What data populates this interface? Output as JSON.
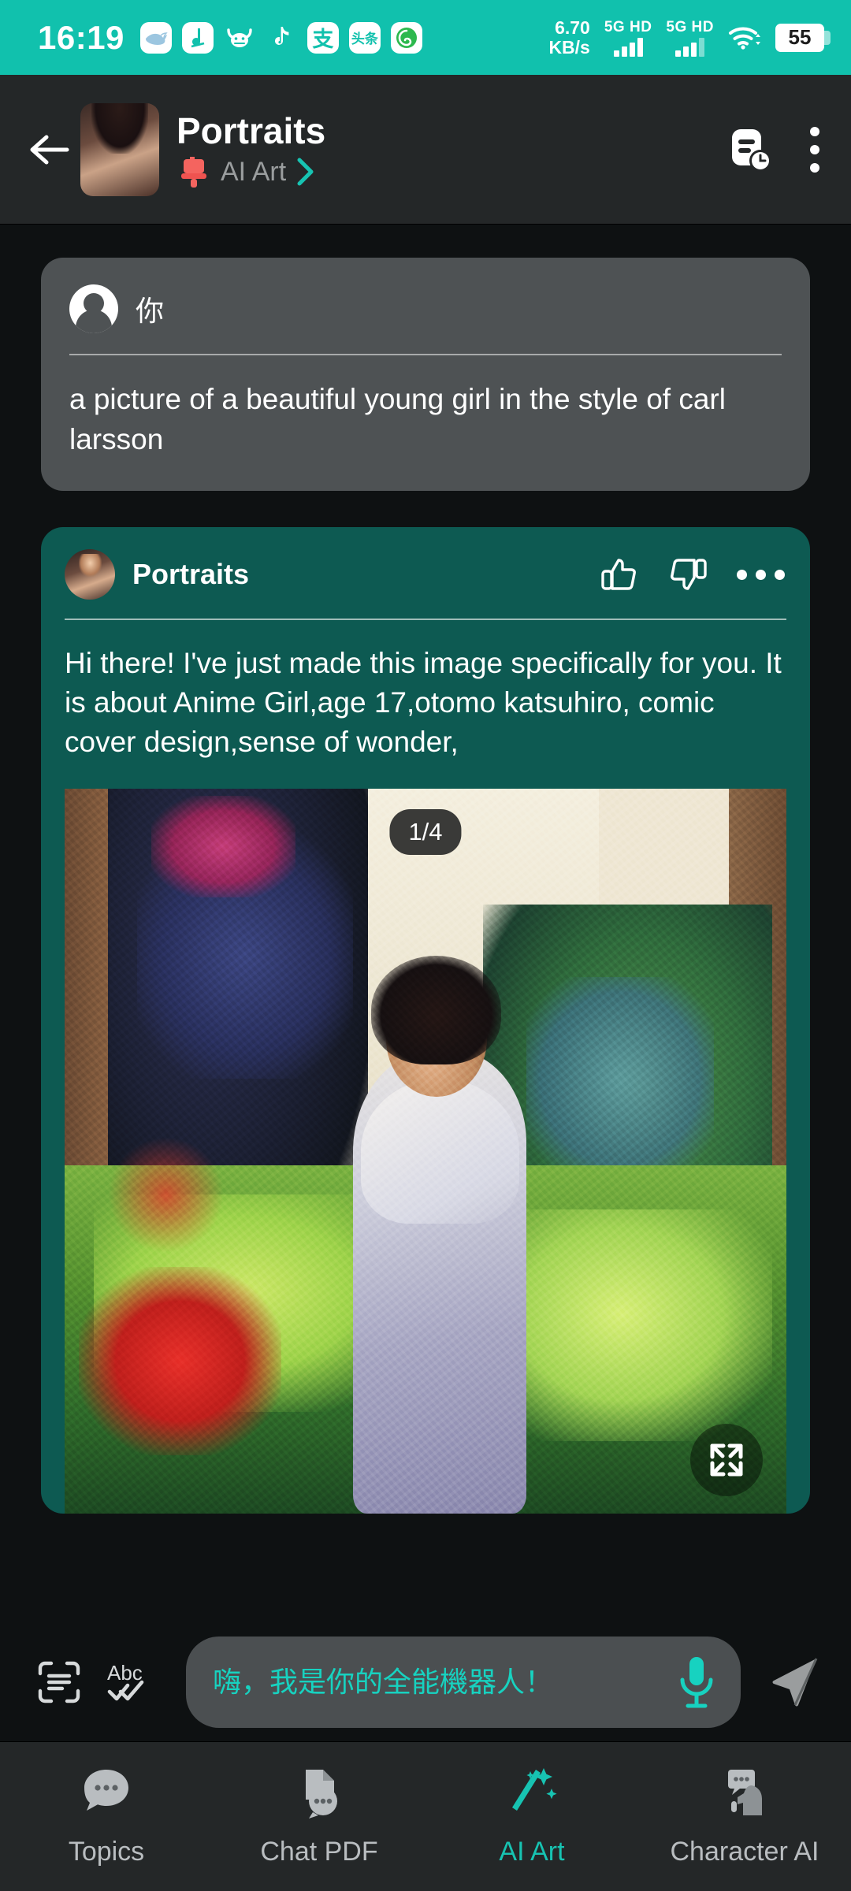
{
  "status_bar": {
    "time": "16:19",
    "app_icons": [
      "whale-icon",
      "j-note-icon",
      "ox-face-icon",
      "tiktok-icon",
      "alipay-icon",
      "toutiao-icon",
      "spiral-icon"
    ],
    "alipay_glyph": "支",
    "toutiao_glyph": "头条",
    "j_glyph": "J",
    "network_speed_value": "6.70",
    "network_speed_unit": "KB/s",
    "sim1_label": "5G HD",
    "sim2_label": "5G HD",
    "wifi_icon": "wifi-icon",
    "battery_percent": "55",
    "bg_color": "#11c1ad"
  },
  "header": {
    "back_icon": "back-arrow-icon",
    "avatar": "portraits-avatar",
    "title": "Portraits",
    "category_icon": "paintbrush-icon",
    "category_label": "AI Art",
    "chevron_icon": "chevron-right-icon",
    "history_icon": "history-document-icon",
    "overflow_icon": "more-vertical-icon",
    "accent_color": "#17c3b2",
    "brush_color": "#f4645f"
  },
  "conversation": {
    "user_message": {
      "avatar_icon": "user-avatar-icon",
      "sender": "你",
      "text": "a picture of a beautiful young girl in the style of carl larsson",
      "bg_color": "#4e5254"
    },
    "bot_message": {
      "avatar": "portraits-avatar",
      "sender": "Portraits",
      "like_icon": "thumbs-up-icon",
      "dislike_icon": "thumbs-down-icon",
      "overflow_icon": "more-horizontal-icon",
      "text": "Hi there! I've just made this image specifically for you. It is about Anime Girl,age 17,otomo katsuhiro, comic cover design,sense of wonder,",
      "bg_color": "#0d5a52",
      "image": {
        "counter": "1/4",
        "expand_icon": "fullscreen-expand-icon",
        "alt": "impressionist painting of a young woman in a pale dress standing in a sunlit garden"
      }
    }
  },
  "input_bar": {
    "scan_icon": "scan-text-icon",
    "spellcheck_icon": "abc-check-icon",
    "placeholder": "嗨，我是你的全能機器人！",
    "mic_icon": "microphone-icon",
    "send_icon": "send-icon",
    "accent_color": "#17d2c0"
  },
  "bottom_nav": {
    "items": [
      {
        "label": "Topics",
        "icon": "chat-bubble-icon",
        "active": false
      },
      {
        "label": "Chat PDF",
        "icon": "document-chat-icon",
        "active": false
      },
      {
        "label": "AI Art",
        "icon": "magic-wand-icon",
        "active": true
      },
      {
        "label": "Character AI",
        "icon": "character-chat-icon",
        "active": false
      }
    ],
    "active_color": "#17c3b2",
    "inactive_color": "#b9bdc0"
  }
}
